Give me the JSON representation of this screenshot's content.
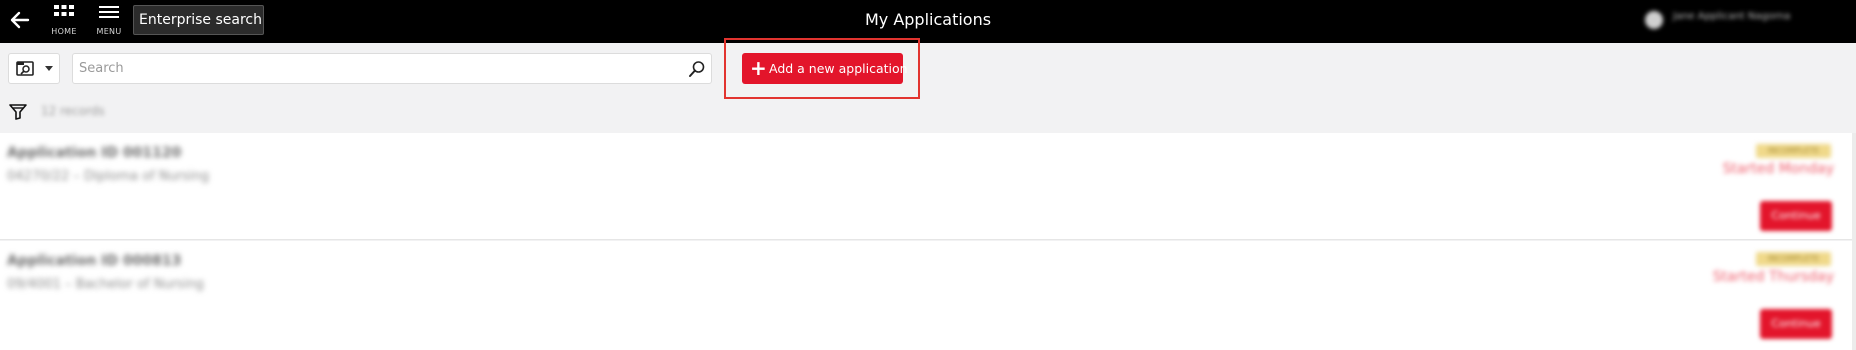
{
  "header": {
    "title": "My Applications",
    "nav": {
      "home_label": "HOME",
      "menu_label": "MENU"
    },
    "enterprise_search": {
      "value": "Enterprise search"
    },
    "user": {
      "name": "Jane Applicant Nagorna"
    }
  },
  "toolbar": {
    "search_placeholder": "Search",
    "add_button_label": "Add a new application",
    "accent_color": "#e3152b"
  },
  "filter": {
    "record_count_text": "12 records"
  },
  "applications": [
    {
      "title": "Application ID 001120",
      "subtitle": "04270/22 – Diploma of Nursing",
      "badge": "INCOMPLETE",
      "status": "Started Monday",
      "action_label": "Continue"
    },
    {
      "title": "Application ID 000813",
      "subtitle": "09/4001 – Bachelor of Nursing",
      "badge": "INCOMPLETE",
      "status": "Started Thursday",
      "action_label": "Continue"
    }
  ]
}
